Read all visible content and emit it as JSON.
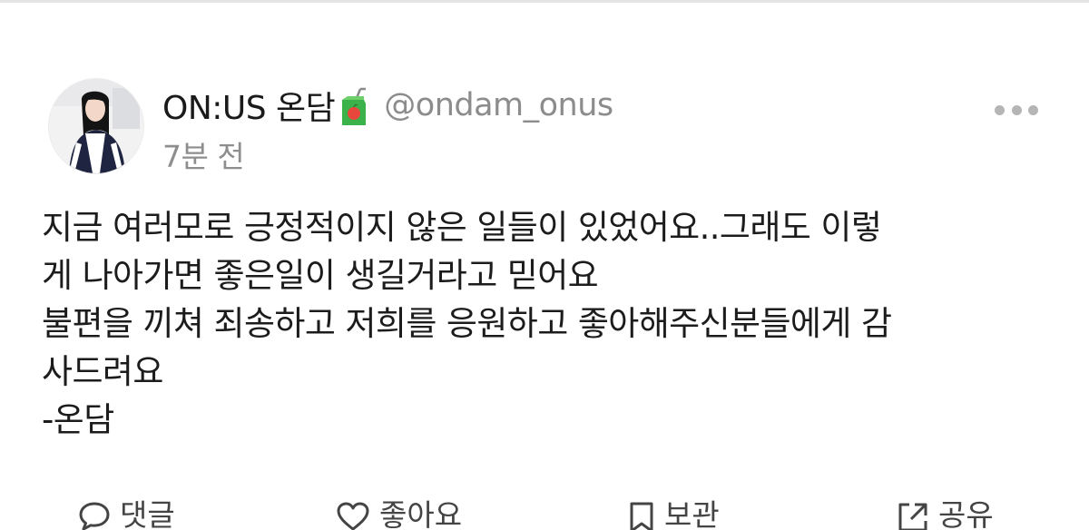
{
  "post": {
    "author": {
      "display_name": "ON:US 온담",
      "handle": "@ondam_onus",
      "badge_icon": "juice-box-icon"
    },
    "time": "7분 전",
    "lines": [
      "지금 여러모로 긍정적이지 않은 일들이 있었어요..그래도 이렇",
      "게 나아가면 좋은일이 생길거라고 믿어요",
      "불편을 끼쳐 죄송하고 저희를 응원하고 좋아해주신분들에게 감",
      "사드려요",
      "-온담"
    ]
  },
  "actions": {
    "comment": {
      "label": "댓글",
      "icon": "comment-icon"
    },
    "like": {
      "label": "좋아요",
      "icon": "heart-icon"
    },
    "save": {
      "label": "보관",
      "icon": "bookmark-icon"
    },
    "share": {
      "label": "공유",
      "icon": "share-icon"
    }
  },
  "colors": {
    "text": "#1c1c1c",
    "muted": "#8c8c8c",
    "icon": "#444444",
    "juice_green": "#3bb34a",
    "juice_red": "#e8473c"
  }
}
